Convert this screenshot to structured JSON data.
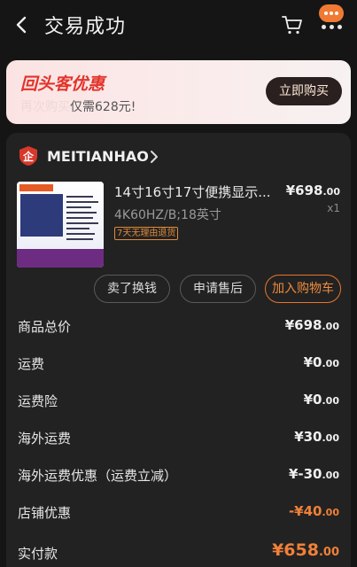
{
  "header": {
    "title": "交易成功"
  },
  "promo": {
    "title": "回头客优惠",
    "subtitle_prefix": "再次购买",
    "subtitle_main": "仅需628元!",
    "button": "立即购买"
  },
  "shop": {
    "name": "MEITIANHAO",
    "logo_text": "企"
  },
  "product": {
    "name": "14寸16寸17寸便携显示...",
    "spec": "4K60HZ/B;18英寸",
    "badge": "7天无理由退货",
    "price_main": "¥698",
    "price_cents": ".00",
    "qty": "x1"
  },
  "actions": {
    "sell": "卖了换钱",
    "after_sale": "申请售后",
    "add_cart": "加入购物车"
  },
  "summary": [
    {
      "label": "商品总价",
      "value": "¥698",
      "cents": ".00"
    },
    {
      "label": "运费",
      "value": "¥0",
      "cents": ".00"
    },
    {
      "label": "运费险",
      "value": "¥0",
      "cents": ".00"
    },
    {
      "label": "海外运费",
      "value": "¥30",
      "cents": ".00"
    },
    {
      "label": "海外运费优惠（运费立减）",
      "value": "¥-30",
      "cents": ".00"
    },
    {
      "label": "店铺优惠",
      "value": "-¥40",
      "cents": ".00"
    },
    {
      "label": "实付款",
      "value": "¥658",
      "cents": ".00"
    }
  ],
  "colors": {
    "background": "#151515",
    "card": "#222222",
    "accent": "#f0803a",
    "promo_red": "#e2342b"
  }
}
